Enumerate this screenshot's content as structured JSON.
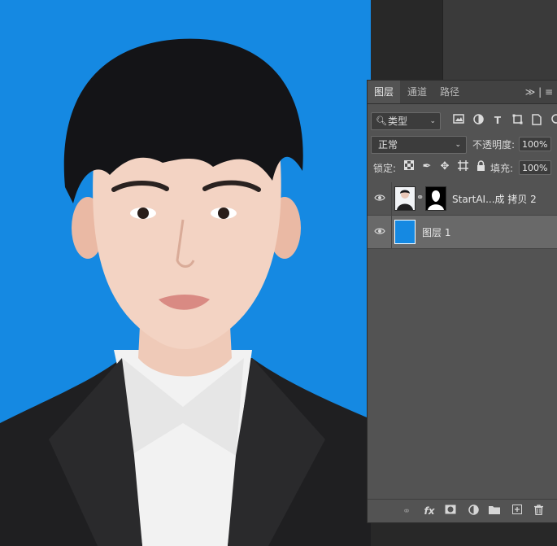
{
  "layers_panel": {
    "tabs": [
      {
        "label": "图层",
        "active": true
      },
      {
        "label": "通道",
        "active": false
      },
      {
        "label": "路径",
        "active": false
      }
    ],
    "menu_symbol": "≫ | ≡",
    "filter": {
      "label": "类型",
      "icon": "search-icon"
    },
    "filter_icons": [
      "image-filter-icon",
      "adjustment-filter-icon",
      "type-filter-icon",
      "shape-filter-icon",
      "smart-object-filter-icon"
    ],
    "blend_mode": "正常",
    "opacity_label": "不透明度:",
    "opacity_value": "100%",
    "lock_label": "锁定:",
    "lock_icons": [
      "lock-transparent-pixels-icon",
      "lock-image-pixels-icon",
      "lock-position-icon",
      "lock-artboard-icon",
      "lock-all-icon"
    ],
    "fill_label": "填充:",
    "fill_value": "100%",
    "layers": [
      {
        "name": "StartAI...成 拷贝 2",
        "visible": true,
        "selected": false,
        "has_mask": true
      },
      {
        "name": "图层 1",
        "visible": true,
        "selected": true,
        "fill_color": "#1589e2"
      }
    ],
    "bottom_icons": [
      "link-layers-icon",
      "fx-icon",
      "add-mask-icon",
      "adjustment-layer-icon",
      "group-folder-icon",
      "new-layer-icon",
      "trash-icon"
    ],
    "fx_label": "fx"
  },
  "colors": {
    "canvas_background": "#1589e2",
    "panel_background": "#535353",
    "selected_layer": "#696969"
  }
}
